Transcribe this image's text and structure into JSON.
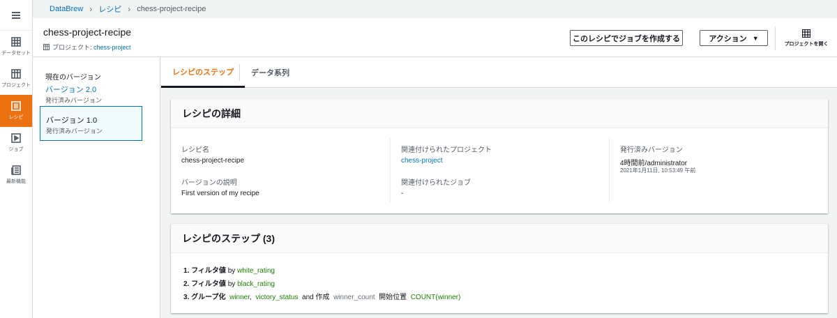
{
  "breadcrumb": {
    "root": "DataBrew",
    "mid": "レシピ",
    "current": "chess-project-recipe"
  },
  "rail": [
    {
      "label": "データセット",
      "icon": "table-icon"
    },
    {
      "label": "プロジェクト",
      "icon": "grid-icon"
    },
    {
      "label": "レシピ",
      "icon": "list-icon",
      "active": true
    },
    {
      "label": "ジョブ",
      "icon": "play-icon"
    },
    {
      "label": "最新機能",
      "icon": "news-icon"
    }
  ],
  "header": {
    "title": "chess-project-recipe",
    "project_prefix": "プロジェクト:",
    "project_name": "chess-project",
    "create_job_label": "このレシピでジョブを作成する",
    "action_label": "アクション",
    "open_project_label": "プロジェクトを開く"
  },
  "versions": {
    "current_label": "現在のバージョン",
    "current_version": "バージョン 2.0",
    "current_sub": "発行済みバージョン",
    "selected_version": "バージョン 1.0",
    "selected_sub": "発行済みバージョン"
  },
  "tabs": {
    "steps": "レシピのステップ",
    "lineage": "データ系列"
  },
  "details": {
    "heading": "レシピの詳細",
    "name_label": "レシピ名",
    "name_value": "chess-project-recipe",
    "desc_label": "バージョンの説明",
    "desc_value": "First version of my recipe",
    "project_label": "関連付けられたプロジェクト",
    "project_value": "chess-project",
    "job_label": "関連付けられたジョブ",
    "job_value": "-",
    "published_label": "発行済みバージョン",
    "published_value": "4時間前/administrator",
    "published_time": "2021年1月11日, 10:53:49 午前"
  },
  "steps": {
    "heading": "レシピのステップ (3)",
    "s1_num": "1.",
    "s1_action": "フィルタ値",
    "s1_by": "by",
    "s1_col": "white_rating",
    "s2_num": "2.",
    "s2_action": "フィルタ値",
    "s2_by": "by",
    "s2_col": "black_rating",
    "s3_num": "3.",
    "s3_action": "グループ化",
    "s3_col1": "winner",
    "s3_comma": ",",
    "s3_col2": "victory_status",
    "s3_and": "and",
    "s3_create": "作成",
    "s3_new": "winner_count",
    "s3_pos": "開始位置",
    "s3_func": "COUNT(winner)"
  },
  "colors": {
    "accent": "#ec7211",
    "link": "#0073bb",
    "green": "#1d8102"
  }
}
